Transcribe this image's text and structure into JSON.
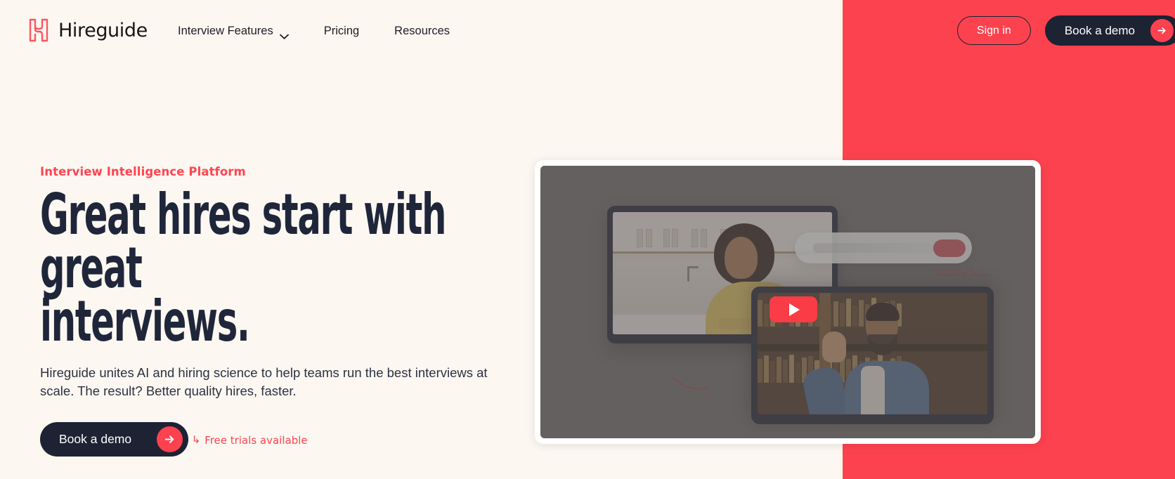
{
  "brand": {
    "name": "Hireguide",
    "logo_icon": "hireguide-h-mark",
    "accent_color": "#fd424f",
    "dark_color": "#1d2333",
    "background_color": "#fdf7f2"
  },
  "nav": {
    "items": [
      {
        "label": "Interview Features",
        "has_dropdown": true,
        "icon": "chevron-down-icon"
      },
      {
        "label": "Pricing",
        "has_dropdown": false
      },
      {
        "label": "Resources",
        "has_dropdown": false
      }
    ]
  },
  "header_actions": {
    "sign_in_label": "Sign in",
    "book_demo_label": "Book a demo",
    "arrow_icon": "arrow-right-icon"
  },
  "hero": {
    "eyebrow": "Interview Intelligence Platform",
    "headline_line1": "Great hires start with great",
    "headline_line2": "interviews.",
    "subtext": "Hireguide unites AI and hiring science to help teams run the best interviews at scale. The result? Better quality hires, faster.",
    "cta_label": "Book a demo",
    "cta_arrow_icon": "arrow-right-icon",
    "trial_arrow": "↳",
    "trial_label": "Free trials available"
  },
  "media": {
    "play_button_icon": "play-icon",
    "play_button_color": "#fa3c46",
    "overlay_color": "#5c5857"
  }
}
